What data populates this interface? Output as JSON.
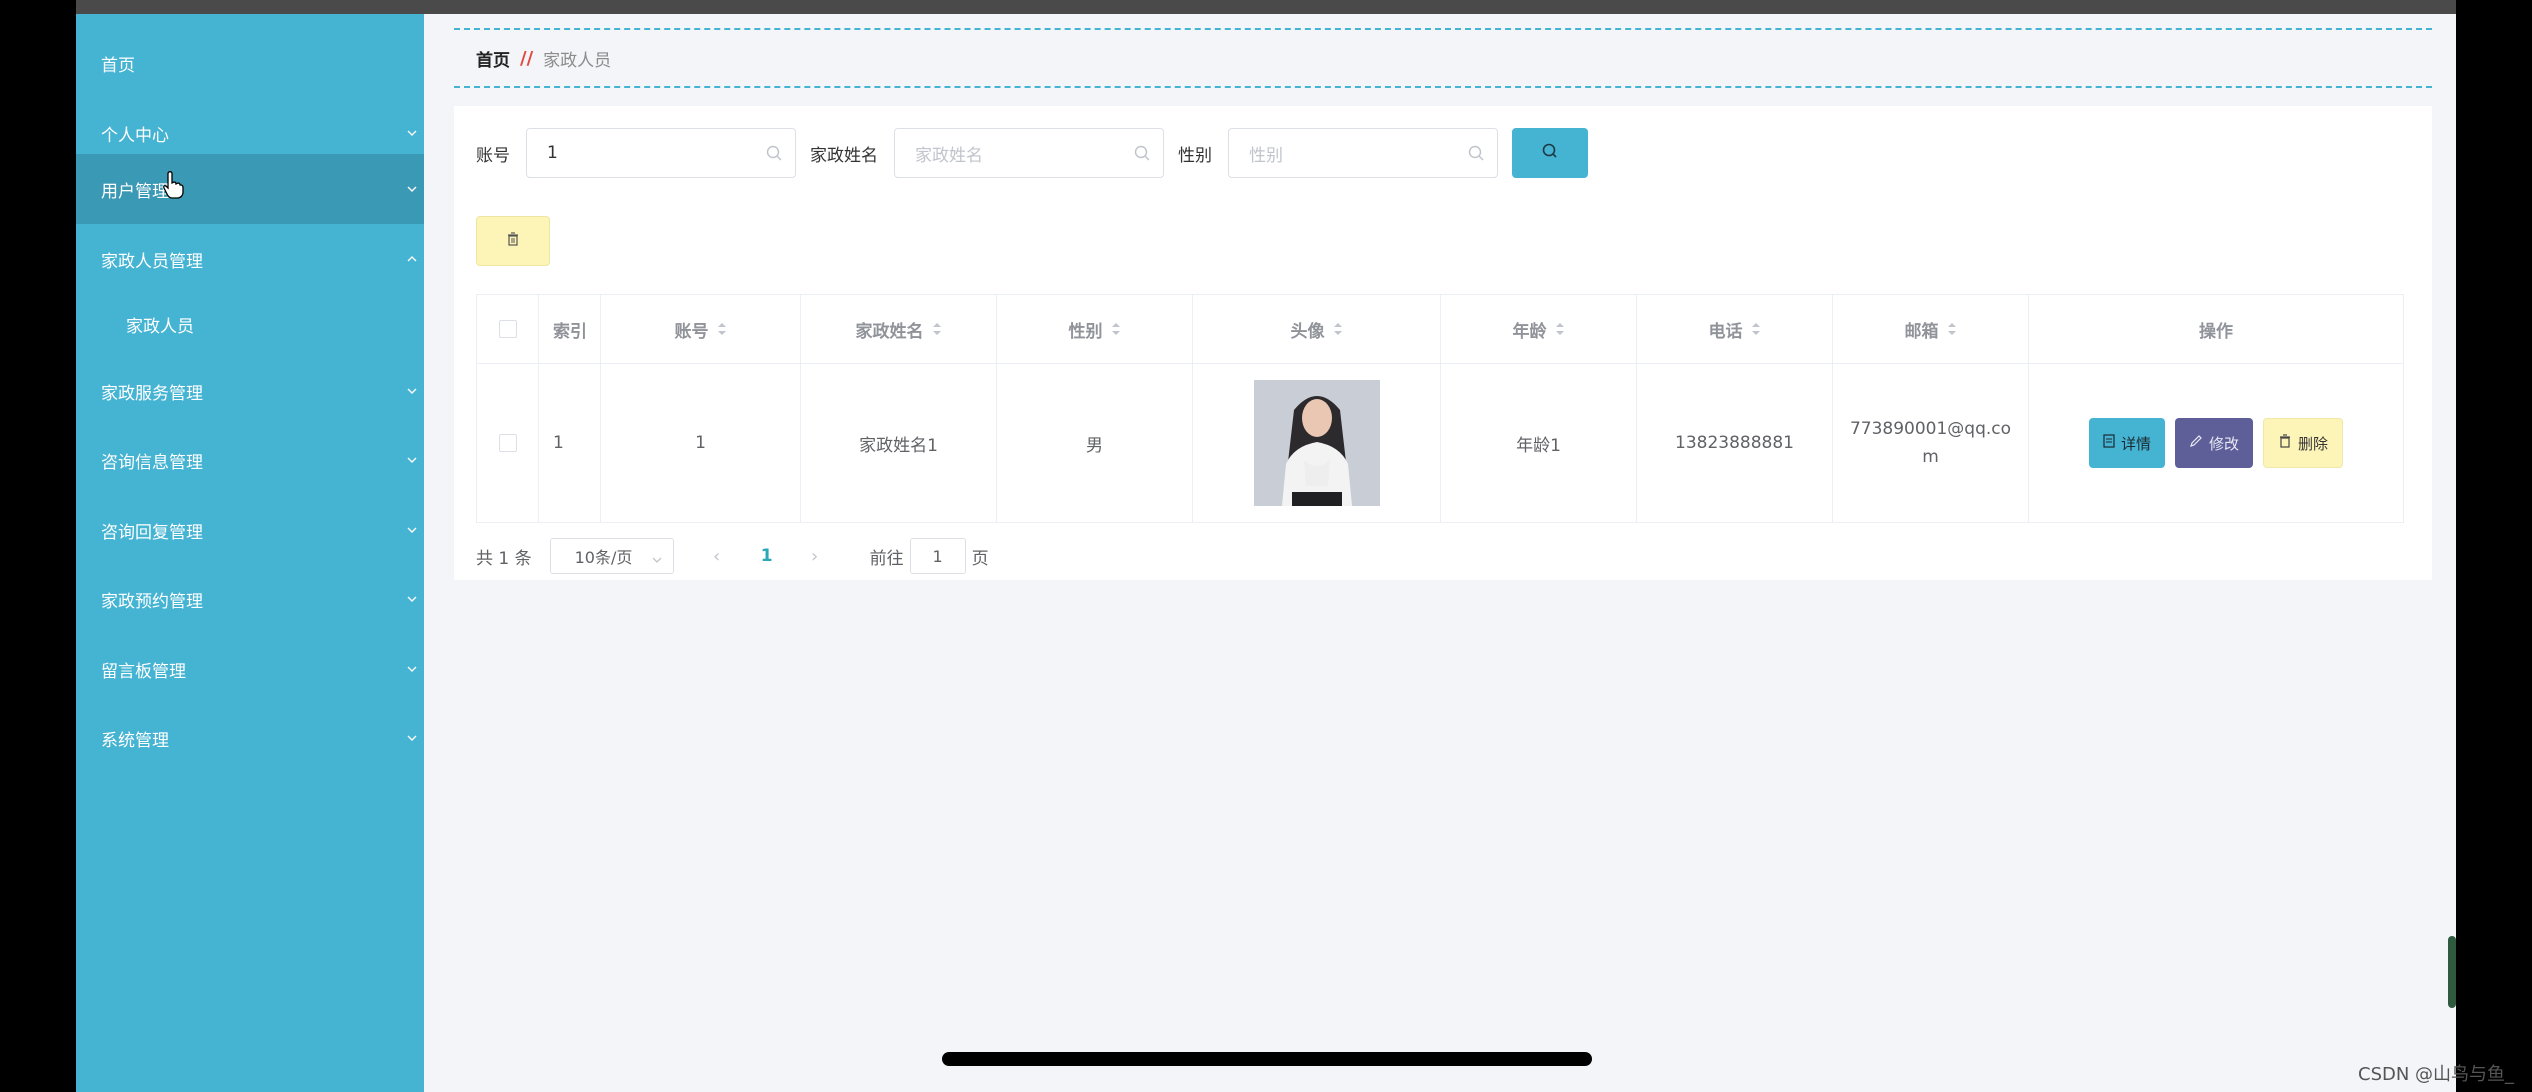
{
  "sidebar": {
    "items": [
      {
        "label": "首页",
        "has_chevron": false
      },
      {
        "label": "个人中心",
        "has_chevron": true
      },
      {
        "label": "用户管理",
        "has_chevron": true
      },
      {
        "label": "家政人员管理",
        "has_chevron": true
      },
      {
        "label": "家政人员",
        "has_chevron": false
      },
      {
        "label": "家政服务管理",
        "has_chevron": true
      },
      {
        "label": "咨询信息管理",
        "has_chevron": true
      },
      {
        "label": "咨询回复管理",
        "has_chevron": true
      },
      {
        "label": "家政预约管理",
        "has_chevron": true
      },
      {
        "label": "留言板管理",
        "has_chevron": true
      },
      {
        "label": "系统管理",
        "has_chevron": true
      }
    ],
    "bg_color": "#45b3d2",
    "active_color": "#3a99b5"
  },
  "breadcrumb": {
    "home": "首页",
    "separator": "//",
    "current": "家政人员"
  },
  "search": {
    "account_label": "账号",
    "account_value": "1",
    "name_label": "家政姓名",
    "name_placeholder": "家政姓名",
    "gender_label": "性别",
    "gender_placeholder": "性别"
  },
  "table": {
    "headers": {
      "index": "索引",
      "account": "账号",
      "name": "家政姓名",
      "gender": "性别",
      "avatar": "头像",
      "age": "年龄",
      "phone": "电话",
      "email": "邮箱",
      "actions": "操作"
    },
    "rows": [
      {
        "index": "1",
        "account": "1",
        "name": "家政姓名1",
        "gender": "男",
        "age": "年龄1",
        "phone": "13823888881",
        "email": "773890001@qq.com"
      }
    ],
    "actions": {
      "detail": "详情",
      "edit": "修改",
      "delete": "删除"
    }
  },
  "pagination": {
    "total": "共 1 条",
    "page_size": "10条/页",
    "current_page": "1",
    "goto_label": "前往",
    "goto_value": "1",
    "page_suffix": "页"
  },
  "watermark": "CSDN @山鸟与鱼_",
  "colors": {
    "accent": "#45b3d2",
    "edit": "#5e5f98",
    "delete": "#fdf5b8"
  }
}
